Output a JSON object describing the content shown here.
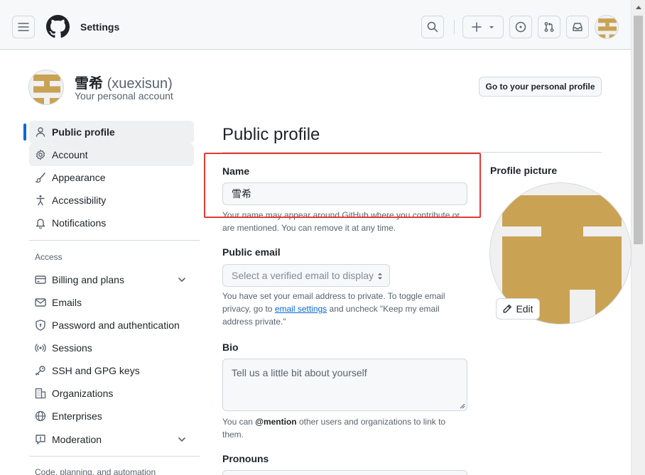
{
  "header": {
    "title": "Settings",
    "menu_icon": "hamburger-icon",
    "logo_icon": "github-mark-icon",
    "search_icon": "search-icon",
    "create_icon": "plus-icon",
    "issues_icon": "issue-opened-icon",
    "pulls_icon": "git-pull-request-icon",
    "inbox_icon": "inbox-icon"
  },
  "account": {
    "display_name": "雪希",
    "login": "(xuexisun)",
    "subtitle": "Your personal account",
    "profile_button": "Go to your personal profile",
    "avatar_color": "#c9a253"
  },
  "sidebar": {
    "items": [
      {
        "label": "Public profile",
        "icon": "person-icon"
      },
      {
        "label": "Account",
        "icon": "gear-icon"
      },
      {
        "label": "Appearance",
        "icon": "paintbrush-icon"
      },
      {
        "label": "Accessibility",
        "icon": "accessibility-icon"
      },
      {
        "label": "Notifications",
        "icon": "bell-icon"
      }
    ],
    "access_heading": "Access",
    "access_items": [
      {
        "label": "Billing and plans",
        "icon": "credit-card-icon"
      },
      {
        "label": "Emails",
        "icon": "mail-icon"
      },
      {
        "label": "Password and authentication",
        "icon": "shield-lock-icon"
      },
      {
        "label": "Sessions",
        "icon": "broadcast-icon"
      },
      {
        "label": "SSH and GPG keys",
        "icon": "key-icon"
      },
      {
        "label": "Organizations",
        "icon": "organization-icon"
      },
      {
        "label": "Enterprises",
        "icon": "globe-icon"
      },
      {
        "label": "Moderation",
        "icon": "report-icon"
      }
    ],
    "code_heading": "Code, planning, and automation"
  },
  "main": {
    "title": "Public profile",
    "name": {
      "label": "Name",
      "value": "雪希",
      "note": "Your name may appear around GitHub where you contribute or are mentioned. You can remove it at any time."
    },
    "email": {
      "label": "Public email",
      "placeholder": "Select a verified email to display",
      "note_before": "You have set your email address to private. To toggle email privacy, go to ",
      "note_link": "email settings",
      "note_after": " and uncheck \"Keep my email address private.\""
    },
    "bio": {
      "label": "Bio",
      "placeholder": "Tell us a little bit about yourself",
      "note_before": "You can ",
      "note_mention": "@mention",
      "note_after": " other users and organizations to link to them."
    },
    "pronouns": {
      "label": "Pronouns"
    }
  },
  "profile_picture": {
    "label": "Profile picture",
    "edit_label": "Edit",
    "edit_icon": "pencil-icon"
  },
  "colors": {
    "accent": "#0969da",
    "highlight_box": "#e53935",
    "avatar_gold": "#c9a253"
  }
}
